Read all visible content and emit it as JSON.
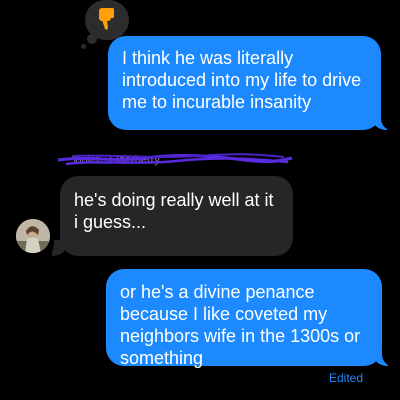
{
  "reaction": {
    "icon": "thumbs-down-icon",
    "color": "#ff9f0a"
  },
  "messages": [
    {
      "direction": "outgoing",
      "text": "I think he was literally introduced into my life to drive me to incurable insanity"
    },
    {
      "direction": "incoming",
      "text": "he's doing really well at it i guess..."
    },
    {
      "direction": "outgoing",
      "text": "or he's a divine penance because I like coveted my neighbors wife in the 1300s or something",
      "status": "Edited"
    }
  ],
  "sender_label": "Violet · Elderberry",
  "colors": {
    "outgoing_bubble": "#1d89ff",
    "incoming_bubble": "#262629",
    "background": "#000000",
    "scribble": "#5a2ae0"
  }
}
